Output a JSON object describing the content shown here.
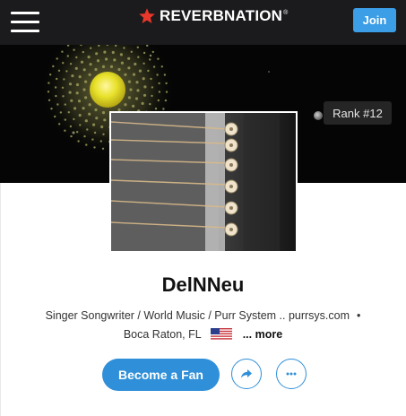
{
  "header": {
    "brand": "REVERBNATION",
    "brand_mark": "®",
    "join_label": "Join",
    "colors": {
      "bar": "#1b1b1d",
      "star": "#e8372b",
      "join": "#3b9ee6"
    }
  },
  "banner": {
    "rank_label": "Rank #12"
  },
  "profile": {
    "name": "DelNNeu",
    "info_line": "Singer Songwriter / World Music / Purr System .. purrsys.com",
    "separator": "•",
    "location": "Boca Raton, FL",
    "more_label": "... more"
  },
  "actions": {
    "fan_label": "Become a Fan",
    "share_icon": "share-arrow-icon",
    "more_icon": "ellipsis-icon",
    "accent": "#2f8fd8"
  }
}
